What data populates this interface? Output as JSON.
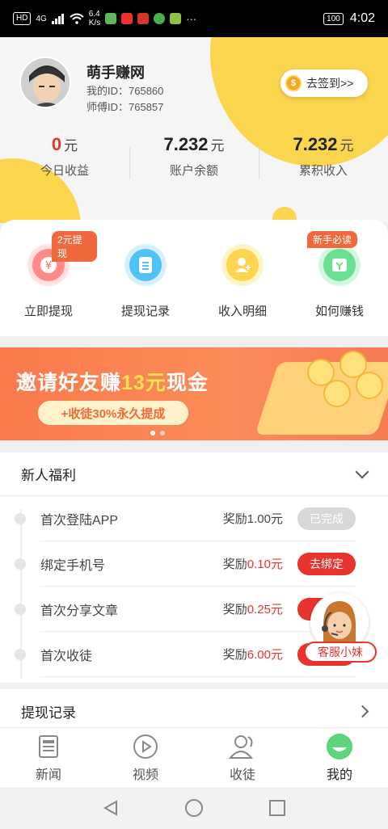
{
  "status_bar": {
    "network": "4G",
    "speed_value": "6.4",
    "speed_unit": "K/s",
    "hd": "HD",
    "battery": "100",
    "time": "4:02",
    "more": "···"
  },
  "profile": {
    "username": "萌手赚网",
    "my_id": "我的ID：765860",
    "master_id": "师傅ID：765857",
    "signin_label": "去签到>>"
  },
  "stats": [
    {
      "value": "0",
      "unit": "元",
      "label": "今日收益",
      "color": "#e8332e"
    },
    {
      "value": "7.232",
      "unit": "元",
      "label": "账户余额"
    },
    {
      "value": "7.232",
      "unit": "元",
      "label": "累积收入"
    }
  ],
  "actions": [
    {
      "label": "立即提现",
      "badge": "2元提现",
      "icon": "yen-icon",
      "color": "#ff8a8a"
    },
    {
      "label": "提现记录",
      "icon": "document-icon",
      "color": "#4fc3f7"
    },
    {
      "label": "收入明细",
      "icon": "user-add-icon",
      "color": "#ffd54f"
    },
    {
      "label": "如何赚钱",
      "badge": "新手必读",
      "icon": "wallet-icon",
      "color": "#69e08f"
    }
  ],
  "banner": {
    "title_prefix": "邀请好友赚",
    "title_highlight": "13元",
    "title_suffix": "现金",
    "pill": "+收徒30%永久提成"
  },
  "benefits": {
    "title": "新人福利",
    "reward_prefix": "奖励",
    "items": [
      {
        "name": "首次登陆APP",
        "amount": "1.00元",
        "button": "已完成",
        "done": true
      },
      {
        "name": "绑定手机号",
        "amount": "0.10元",
        "button": "去绑定",
        "done": false
      },
      {
        "name": "首次分享文章",
        "amount": "0.25元",
        "button": "",
        "done": false
      },
      {
        "name": "首次收徒",
        "amount": "6.00元",
        "button": "",
        "done": false
      }
    ]
  },
  "customer_service": {
    "label": "客服小妹"
  },
  "records": {
    "title": "提现记录"
  },
  "tabs": [
    {
      "label": "新闻",
      "icon": "news-icon"
    },
    {
      "label": "视频",
      "icon": "play-icon"
    },
    {
      "label": "收徒",
      "icon": "users-icon"
    },
    {
      "label": "我的",
      "icon": "profile-icon",
      "active": true
    }
  ],
  "colors": {
    "accent_red": "#e8332e",
    "accent_yellow": "#fbd54e",
    "banner_orange": "#f97a4d",
    "active_tab": "#5ed47b"
  }
}
